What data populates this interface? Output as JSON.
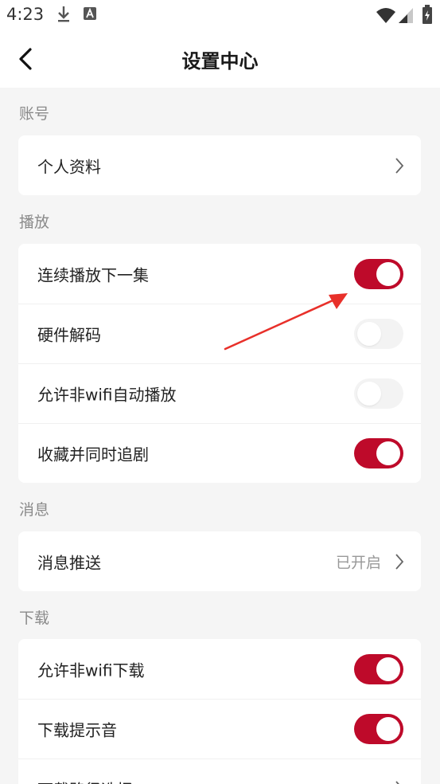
{
  "status_bar": {
    "time": "4:23"
  },
  "nav": {
    "title": "设置中心"
  },
  "colors": {
    "accent": "#be0a2a",
    "annotation_arrow": "#e8302a"
  },
  "sections": {
    "account": {
      "label": "账号",
      "profile": "个人资料"
    },
    "playback": {
      "label": "播放",
      "continuous": {
        "label": "连续播放下一集",
        "on": true
      },
      "hardware": {
        "label": "硬件解码",
        "on": false
      },
      "non_wifi_autoplay": {
        "label": "允许非wifi自动播放",
        "on": false
      },
      "fav_follow": {
        "label": "收藏并同时追剧",
        "on": true
      }
    },
    "message": {
      "label": "消息",
      "push": {
        "label": "消息推送",
        "value": "已开启"
      }
    },
    "download": {
      "label": "下载",
      "non_wifi": {
        "label": "允许非wifi下载",
        "on": true
      },
      "sound": {
        "label": "下载提示音",
        "on": true
      },
      "path": {
        "label": "下载路径选择"
      }
    }
  },
  "icons": [
    "back-icon",
    "chevron-right-icon",
    "download-icon",
    "wifi-icon",
    "signal-icon",
    "battery-icon",
    "annotation-arrow"
  ]
}
